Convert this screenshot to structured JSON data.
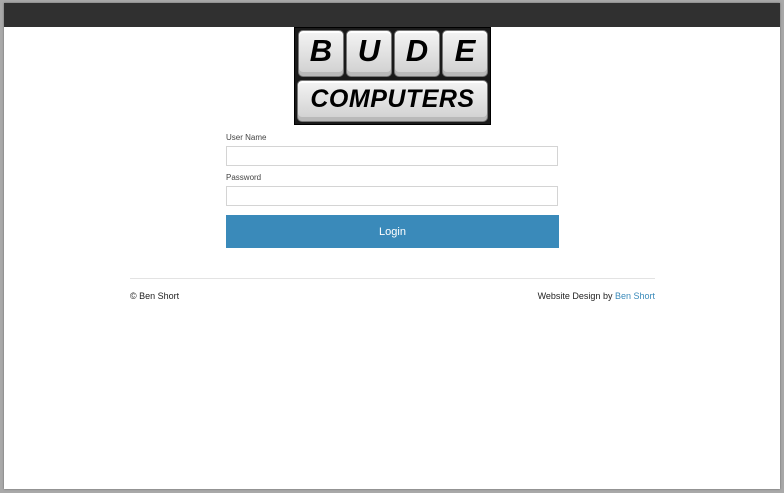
{
  "logo": {
    "letters": [
      "B",
      "U",
      "D",
      "E"
    ],
    "word": "COMPUTERS"
  },
  "form": {
    "username_label": "User Name",
    "username_value": "",
    "password_label": "Password",
    "password_value": "",
    "login_label": "Login"
  },
  "footer": {
    "copyright": "© Ben Short",
    "design_prefix": "Website Design by",
    "designer_link": "Ben Short"
  },
  "colors": {
    "topbar": "#303030",
    "accent": "#3a8aba"
  }
}
